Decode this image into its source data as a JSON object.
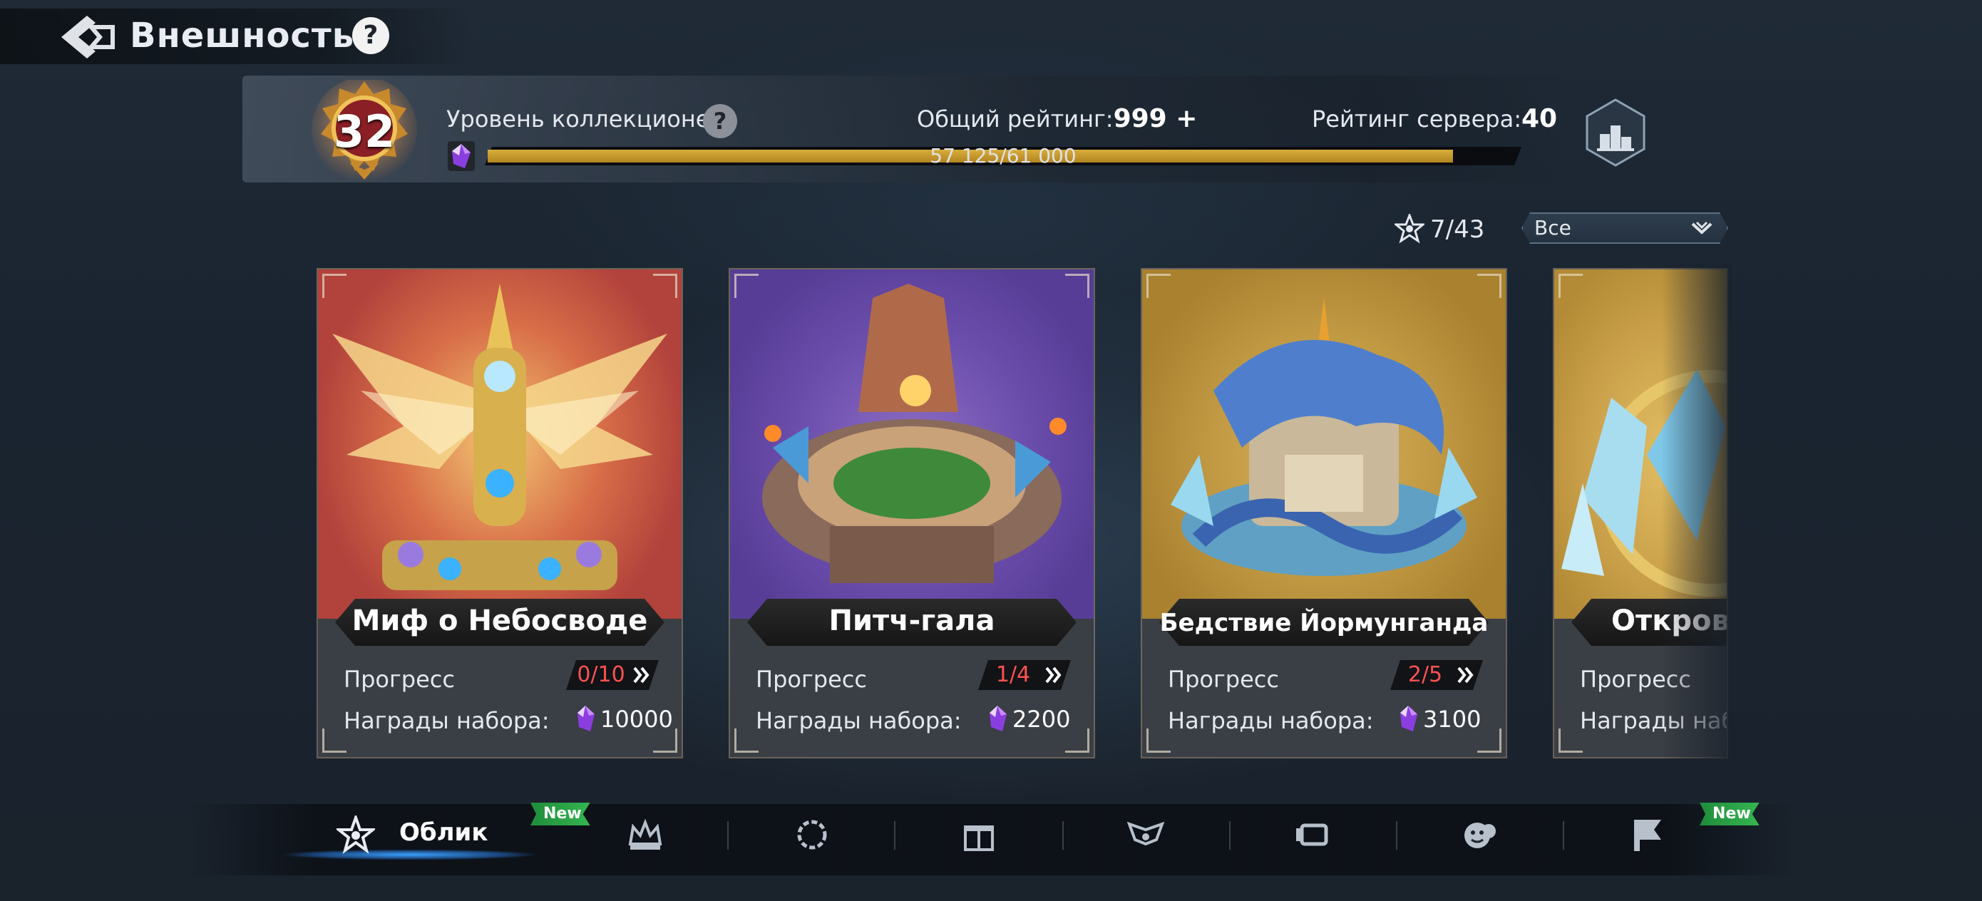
{
  "header": {
    "title": "Внешность",
    "help_symbol": "?"
  },
  "collector": {
    "level": "32",
    "label": "Уровень коллекционера",
    "help_symbol": "?",
    "total_rating_label": "Общий рейтинг:",
    "total_rating_value": "999 +",
    "server_rating_label": "Рейтинг сервера:",
    "server_rating_value": "40",
    "progress_text": "57 125/61 000",
    "progress_fraction": 0.9365
  },
  "filter": {
    "count": "7/43",
    "selected": "Все"
  },
  "cards": [
    {
      "name": "Миф о Небосводе",
      "progress_label": "Прогресс",
      "progress_value": "0/10",
      "reward_label": "Награды набора:",
      "reward_value": "10000"
    },
    {
      "name": "Питч-гала",
      "progress_label": "Прогресс",
      "progress_value": "1/4",
      "reward_label": "Награды набора:",
      "reward_value": "2200"
    },
    {
      "name": "Бедствие Йормунганда",
      "progress_label": "Прогресс",
      "progress_value": "2/5",
      "reward_label": "Награды набора:",
      "reward_value": "3100"
    },
    {
      "name": "Открове",
      "progress_label": "Прогресс",
      "reward_label": "Награды набо"
    }
  ],
  "bottom_nav": {
    "active_tab_label": "Облик",
    "new_badge_text": "New",
    "tabs": [
      {
        "icon": "star-icon",
        "label": "Облик",
        "active": true,
        "new": true
      },
      {
        "icon": "crown-icon"
      },
      {
        "icon": "wreath-icon"
      },
      {
        "icon": "gift-icon"
      },
      {
        "icon": "wings-icon"
      },
      {
        "icon": "frame-icon"
      },
      {
        "icon": "emoji-icon"
      },
      {
        "icon": "flag-icon",
        "new": true
      }
    ]
  },
  "colors": {
    "progress_fill": "#c99a2e",
    "progress_red": "#ff5151",
    "new_badge": "#2aa445",
    "active_tab_glow": "#3aa0ff"
  }
}
